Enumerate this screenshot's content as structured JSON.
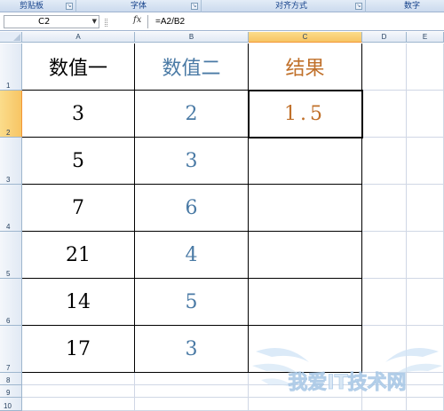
{
  "ribbon": {
    "groups": [
      {
        "label": "剪贴板"
      },
      {
        "label": "字体"
      },
      {
        "label": "对齐方式"
      },
      {
        "label": "数字"
      }
    ]
  },
  "formula_bar": {
    "name_box": "C2",
    "fx_label": "fx",
    "formula": "=A2/B2"
  },
  "columns": [
    "A",
    "B",
    "C",
    "D",
    "E"
  ],
  "rows": [
    "1",
    "2",
    "3",
    "4",
    "5",
    "6",
    "7",
    "8",
    "9",
    "10"
  ],
  "table": {
    "headers": [
      "数值一",
      "数值二",
      "结果"
    ],
    "values_a": [
      "3",
      "5",
      "7",
      "21",
      "14",
      "17"
    ],
    "values_b": [
      "2",
      "3",
      "6",
      "4",
      "5",
      "3"
    ],
    "result": "1.5"
  },
  "selected_cell": "C2",
  "watermark": "我爱IT技术网",
  "colors": {
    "selected_header": "#f7c564",
    "value_blue": "#4a7aa5",
    "result_orange": "#c0702a"
  }
}
